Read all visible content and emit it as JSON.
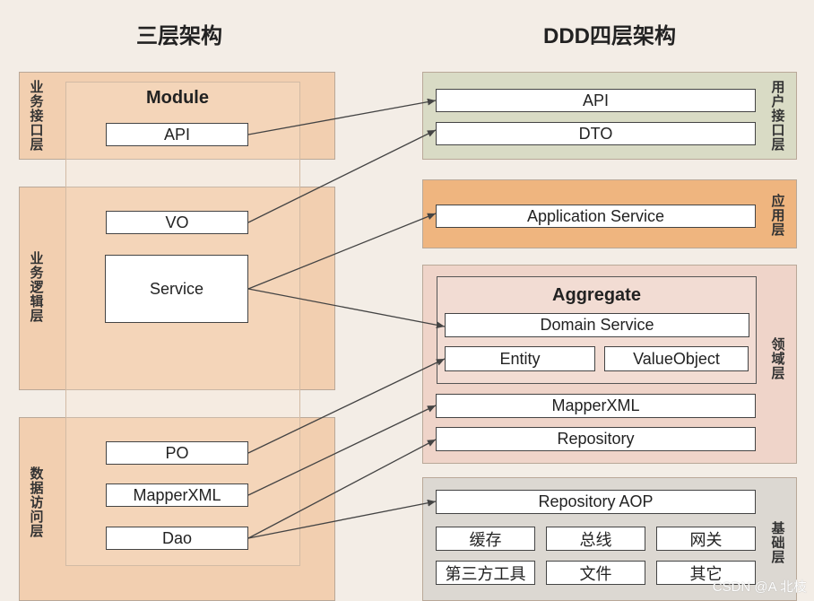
{
  "left": {
    "title": "三层架构",
    "module": "Module",
    "layers": [
      {
        "label": "业务接口层"
      },
      {
        "label": "业务逻辑层"
      },
      {
        "label": "数据访问层"
      }
    ],
    "boxes": [
      "API",
      "VO",
      "Service",
      "PO",
      "MapperXML",
      "Dao"
    ]
  },
  "right": {
    "title": "DDD四层架构",
    "layers": [
      {
        "label": "用户接口层",
        "color": "#d9dbc5"
      },
      {
        "label": "应用层",
        "color": "#efb57f"
      },
      {
        "label": "领域层",
        "color": "#efd4c9"
      },
      {
        "label": "基础层",
        "color": "#dcd8d2"
      }
    ],
    "ui": [
      "API",
      "DTO"
    ],
    "app": [
      "Application Service"
    ],
    "aggregate": "Aggregate",
    "domain": [
      "Domain Service",
      "Entity",
      "ValueObject",
      "MapperXML",
      "Repository"
    ],
    "infra": [
      "Repository AOP",
      "缓存",
      "总线",
      "网关",
      "第三方工具",
      "文件",
      "其它"
    ]
  },
  "watermark": "CSDN @A 北枝",
  "colors": {
    "left_layer": "#f2cfb0",
    "background": "#f3ede6"
  }
}
